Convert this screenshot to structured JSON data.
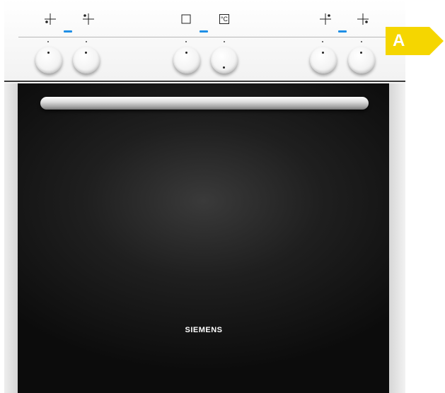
{
  "product": {
    "brand": "SIEMENS",
    "energy_class": "A"
  },
  "colors": {
    "indicator": "#1f8fe6",
    "energy_badge": "#f5d600",
    "door_glass": "#111111"
  },
  "panel": {
    "temperature_unit_symbol": "°C",
    "symbols": [
      "front-left-zone-icon",
      "rear-left-zone-icon",
      "oven-function-icon",
      "temperature-icon",
      "rear-right-zone-icon",
      "front-right-zone-icon"
    ],
    "knobs": [
      "hob-knob-front-left",
      "hob-knob-rear-left",
      "oven-function-knob",
      "temperature-knob",
      "hob-knob-rear-right",
      "hob-knob-front-right"
    ]
  }
}
